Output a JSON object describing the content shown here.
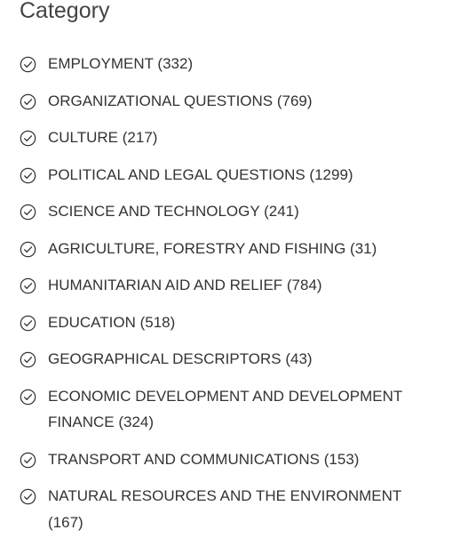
{
  "facet": {
    "title": "Category",
    "items": [
      {
        "label": "EMPLOYMENT (332)",
        "name": "employment"
      },
      {
        "label": "ORGANIZATIONAL QUESTIONS (769)",
        "name": "organizational-questions"
      },
      {
        "label": "CULTURE (217)",
        "name": "culture"
      },
      {
        "label": "POLITICAL AND LEGAL QUESTIONS (1299)",
        "name": "political-and-legal-questions"
      },
      {
        "label": "SCIENCE AND TECHNOLOGY (241)",
        "name": "science-and-technology"
      },
      {
        "label": "AGRICULTURE, FORESTRY AND FISHING (31)",
        "name": "agriculture-forestry-and-fishing"
      },
      {
        "label": "HUMANITARIAN AID AND RELIEF (784)",
        "name": "humanitarian-aid-and-relief"
      },
      {
        "label": "EDUCATION (518)",
        "name": "education"
      },
      {
        "label": "GEOGRAPHICAL DESCRIPTORS (43)",
        "name": "geographical-descriptors"
      },
      {
        "label": "ECONOMIC DEVELOPMENT AND DEVELOPMENT FINANCE (324)",
        "name": "economic-development-and-development-finance"
      },
      {
        "label": "TRANSPORT AND COMMUNICATIONS (153)",
        "name": "transport-and-communications"
      },
      {
        "label": "NATURAL RESOURCES AND THE ENVIRONMENT (167)",
        "name": "natural-resources-and-the-environment"
      }
    ],
    "icon": "check-circle-icon"
  },
  "colors": {
    "text": "#333333",
    "title": "#444444",
    "icon": "#333333"
  }
}
